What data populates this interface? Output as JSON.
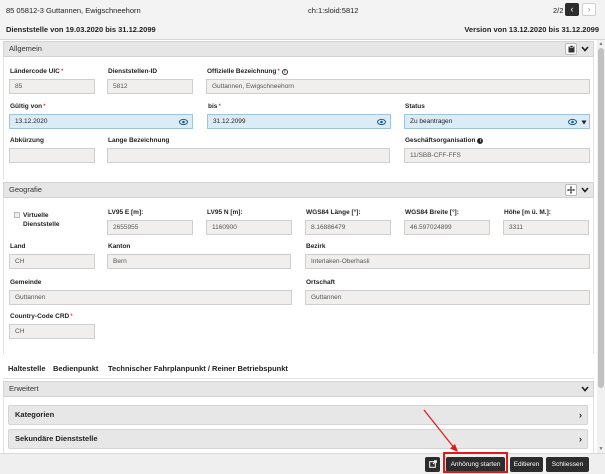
{
  "header": {
    "title": "85 05812-3 Guttannen, Ewigschneehorn",
    "sloid": "ch:1:sloid:5812",
    "pages": "2/2",
    "validity": "Dienststelle von 19.03.2020 bis 31.12.2099",
    "version": "Version von 13.12.2020 bis 31.12.2099"
  },
  "allgemein": {
    "heading": "Allgemein",
    "laendercode_label": "Ländercode UIC",
    "laendercode_value": "85",
    "dienststellen_id_label": "Dienststellen-ID",
    "dienststellen_id_value": "5812",
    "offizielle_label": "Offizielle Bezeichnung",
    "offizielle_value": "Guttannen, Ewigschneehorn",
    "gueltig_von_label": "Gültig von",
    "gueltig_von_value": "13.12.2020",
    "bis_label": "bis",
    "bis_value": "31.12.2099",
    "status_label": "Status",
    "status_value": "Zu beantragen",
    "abkuerzung_label": "Abkürzung",
    "abkuerzung_value": "",
    "lange_label": "Lange Bezeichnung",
    "lange_value": "",
    "geschaeftsorg_label": "Geschäftsorganisation",
    "geschaeftsorg_value": "11/SBB-CFF-FFS",
    "required_mark": "*",
    "info_mark": "!"
  },
  "geografie": {
    "heading": "Geografie",
    "virtuelle_label": "Virtuelle Dienststelle",
    "lv95e_label": "LV95 E [m]:",
    "lv95e_value": "2655955",
    "lv95n_label": "LV95 N [m]:",
    "lv95n_value": "1160900",
    "wgs_laenge_label": "WGS84 Länge [°]:",
    "wgs_laenge_value": "8.16886479",
    "wgs_breite_label": "WGS84 Breite [°]:",
    "wgs_breite_value": "46.597024899",
    "hoehe_label": "Höhe [m ü. M.]:",
    "hoehe_value": "3311",
    "land_label": "Land",
    "land_value": "CH",
    "kanton_label": "Kanton",
    "kanton_value": "Bern",
    "bezirk_label": "Bezirk",
    "bezirk_value": "Interlaken-Oberhasli",
    "gemeinde_label": "Gemeinde",
    "gemeinde_value": "Guttannen",
    "ortschaft_label": "Ortschaft",
    "ortschaft_value": "Guttannen",
    "country_code_label": "Country-Code CRD",
    "country_code_value": "CH"
  },
  "function_tabs": [
    "Haltestelle",
    "Bedienpunkt",
    "Technischer Fahrplanpunkt / Reiner Betriebspunkt"
  ],
  "erweitert": {
    "heading": "Erweitert",
    "kategorien": "Kategorien",
    "sekundaere": "Sekundäre Dienststelle"
  },
  "footer": {
    "anhoerung_label": "Anhörung starten",
    "editieren_label": "Editieren",
    "schliessen_label": "Schliessen"
  },
  "icons": {
    "prev": "chevron-left-icon",
    "next": "chevron-right-icon",
    "clipboard": "clipboard-icon",
    "collapse": "chevron-down-icon",
    "move": "move-icon",
    "eye": "eye-icon",
    "external": "external-link-icon"
  },
  "colors": {
    "highlight": "#e01818",
    "active_field": "#dcecf6",
    "dark_button": "#2c2c2c"
  }
}
